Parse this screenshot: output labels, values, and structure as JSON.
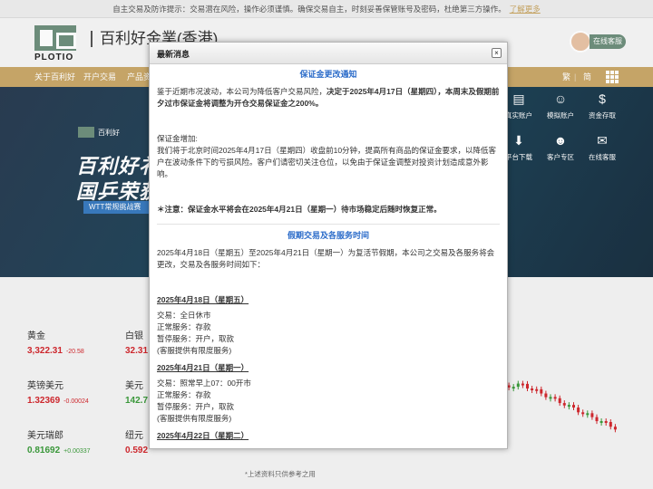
{
  "topbar": {
    "text": "自主交易及防诈提示：交易潜在风险，操作必须谨慎。确保交易自主，时刻妥善保管账号及密码，杜绝第三方操作。",
    "link": "了解更多"
  },
  "header": {
    "logo_text": "PLOTIO",
    "brand": "百利好金業(香港)",
    "cs_label": "在线客服"
  },
  "nav": {
    "items": [
      "关于百利好",
      "开户交易",
      "产品资"
    ],
    "lang_trad": "繁",
    "lang_simp": "简"
  },
  "banner": {
    "logo_text": "百利好",
    "line1": "百利好衤",
    "line2": "国乒荣获",
    "tag": "WTT常规挑战赛"
  },
  "quick_links": [
    "真实账户",
    "模拟账户",
    "资金存取",
    "平台下载",
    "客户专区",
    "在线客服"
  ],
  "quotes": [
    {
      "name": "黄金",
      "price": "3,322.31",
      "change": "-20.58",
      "dir": "down"
    },
    {
      "name": "白银",
      "price": "32.31",
      "change": "",
      "dir": "down"
    },
    {
      "name": "英镑美元",
      "price": "1.32369",
      "change": "-0.00024",
      "dir": "down"
    },
    {
      "name": "美元",
      "price": "142.7",
      "change": "",
      "dir": "up"
    },
    {
      "name": "美元瑞郎",
      "price": "0.81692",
      "change": "+0.00337",
      "dir": "up"
    },
    {
      "name": "纽元",
      "price": "0.592",
      "change": "",
      "dir": "down"
    }
  ],
  "footnote": "*上述资料只供参考之用",
  "modal": {
    "title": "最新消息",
    "close": "×",
    "section1_title": "保证金更改通知",
    "p1_a": "鉴于近期市况波动，本公司为降低客户交易风险，",
    "p1_b": "决定于2025年4月17日（星期四），本周末及假期前夕过市保证金将调整为开仓交易保证金之200%。",
    "p2_label": "保证金增加:",
    "p2_text": "我们将于北京时间2025年4月17日（星期四）收盘前10分钟，提高所有商品的保证金要求，以降低客户在波动条件下的亏损风险。客户们请密切关注仓位，以免由于保证金调整对投资计划造成意外影响。",
    "note": "＊注意：保证金水平将会在2025年4月21日（星期一）待市场稳定后随时恢复正常。",
    "section2_title": "假期交易及各服务时间",
    "p3": "2025年4月18日（星期五）至2025年4月21日（星期一）为复活节假期，本公司之交易及各服务将会更改，交易及各服务时间如下：",
    "d1_title": "2025年4月18日（星期五）",
    "d1_l1": "交易：全日休市",
    "d1_l2": "正常服务：存款",
    "d1_l3": "暂停服务：开户，取款",
    "d1_l4": "(客服提供有限度服务)",
    "d2_title": "2025年4月21日（星期一）",
    "d2_l1": "交易：照常早上07：00开市",
    "d2_l2": "正常服务：存款",
    "d2_l3": "暂停服务：开户，取款",
    "d2_l4": "(客服提供有限度服务)",
    "d3_title": "2025年4月22日（星期二）"
  },
  "colors": {
    "gold": "#c9a86a",
    "brand_green": "#6f8f7d",
    "down": "#d2282e",
    "up": "#3b9b3b",
    "link_blue": "#2a6bc9"
  }
}
